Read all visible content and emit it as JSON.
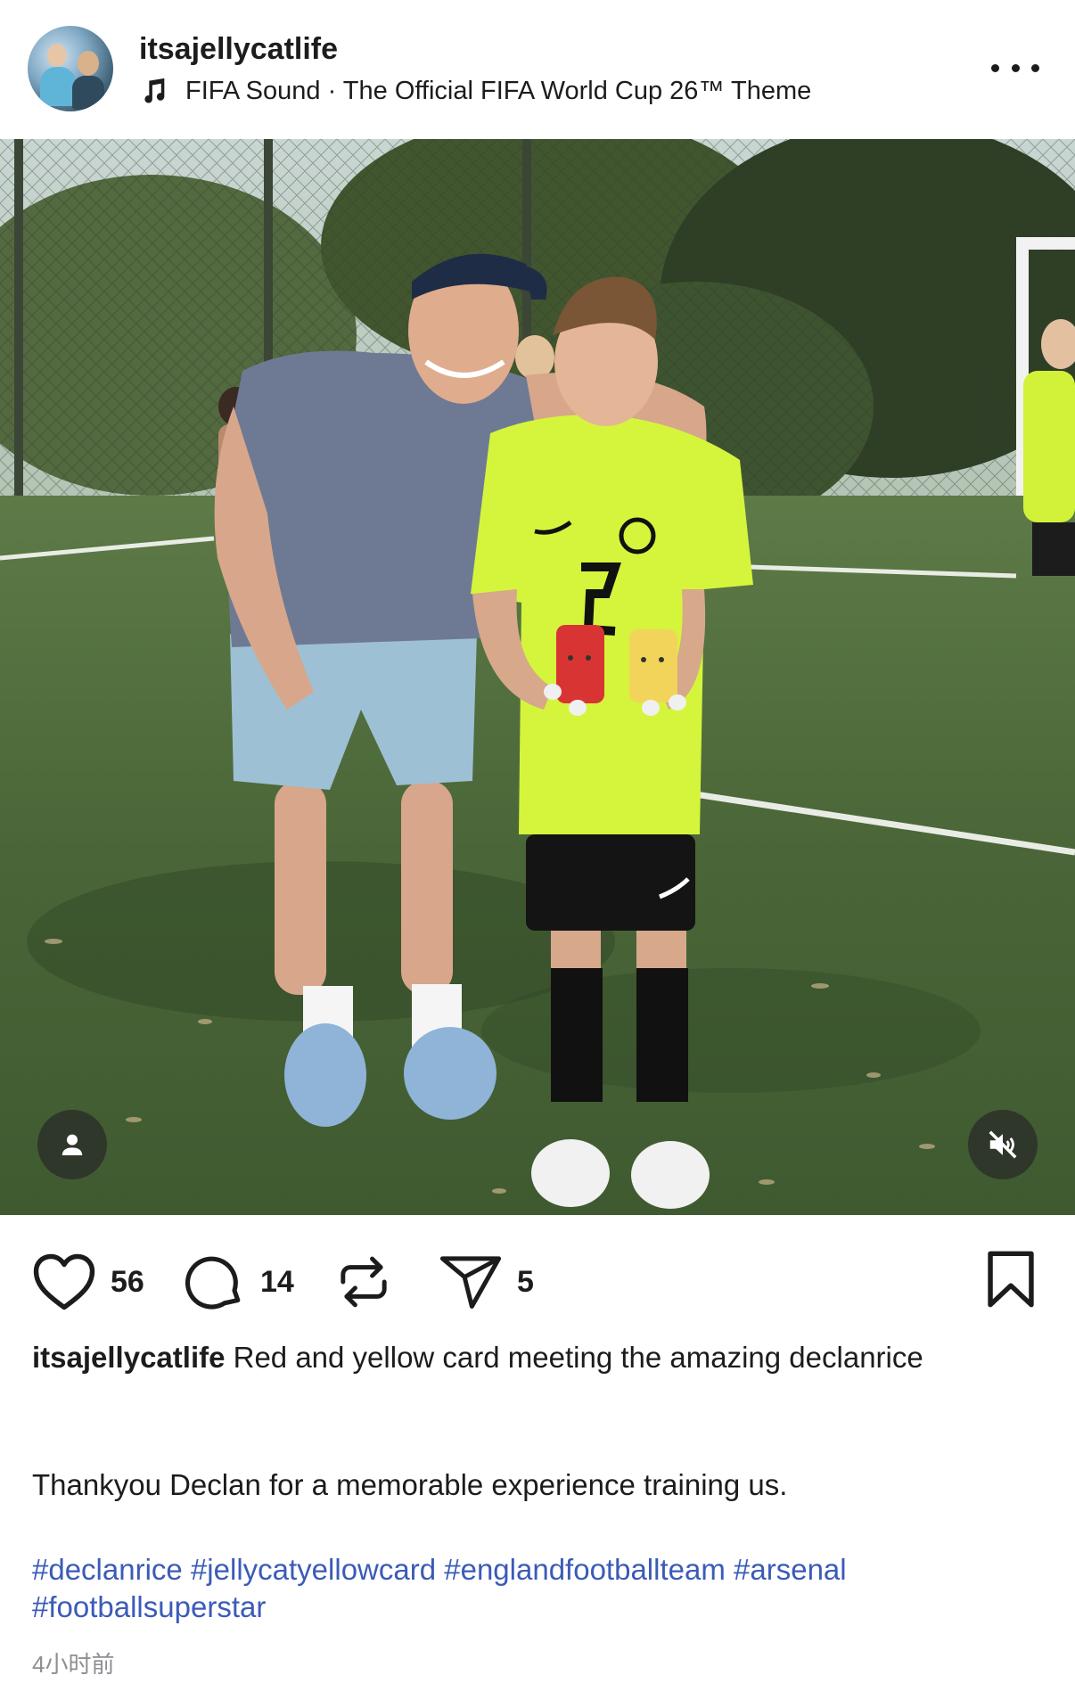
{
  "post": {
    "username": "itsajellycatlife",
    "music": {
      "icon": "music-note-icon",
      "text": "FIFA Sound · The Official FIFA World Cup 26™ Theme"
    },
    "more_icon": "more-horizontal-icon"
  },
  "media": {
    "tag_icon": "person-icon",
    "mute_icon": "speaker-muted-icon"
  },
  "actions": {
    "likes": "56",
    "comments": "14",
    "shares": "5",
    "like_icon": "heart-icon",
    "comment_icon": "comment-bubble-icon",
    "repost_icon": "repost-icon",
    "send_icon": "send-icon",
    "save_icon": "bookmark-icon"
  },
  "caption": {
    "username": "itsajellycatlife",
    "text_line1": " Red and yellow card meeting the amazing declanrice",
    "text_line2": "Thankyou Declan for a memorable experience training us.",
    "hashtags": [
      "#declanrice",
      "#jellycatyellowcard",
      "#englandfootballteam",
      "#arsenal",
      "#footballsuperstar"
    ]
  },
  "timestamp": "4小时前",
  "colors": {
    "text": "#1c1c1e",
    "hashtag": "#3b5bb8",
    "muted": "#8e8e93",
    "pitch": "#4e6a3c",
    "jersey": "#d4f53c"
  }
}
